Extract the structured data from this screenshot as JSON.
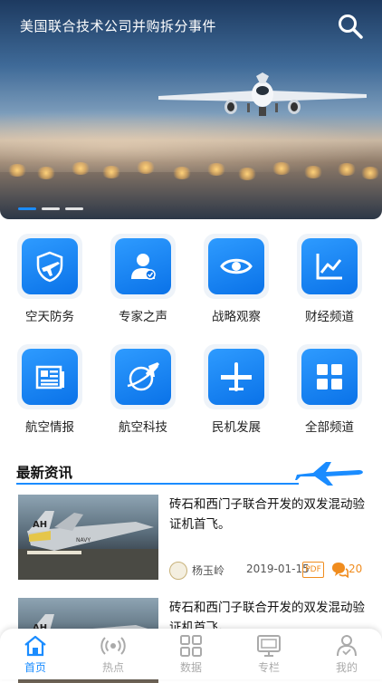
{
  "banner": {
    "title": "美国联合技术公司并购拆分事件",
    "search_icon": "search-icon",
    "slides": 3,
    "active_slide": 0
  },
  "categories": [
    {
      "label": "空天防务",
      "icon": "plane-shield-icon"
    },
    {
      "label": "专家之声",
      "icon": "expert-user-icon"
    },
    {
      "label": "战略观察",
      "icon": "eye-icon"
    },
    {
      "label": "财经频道",
      "icon": "line-chart-icon"
    },
    {
      "label": "航空情报",
      "icon": "newspaper-icon"
    },
    {
      "label": "航空科技",
      "icon": "orbit-plane-icon"
    },
    {
      "label": "民机发展",
      "icon": "airliner-icon"
    },
    {
      "label": "全部频道",
      "icon": "grid-icon"
    }
  ],
  "section": {
    "title": "最新资讯",
    "icon": "jet-plane-icon"
  },
  "news": [
    {
      "headline": "砖石和西门子联合开发的双发混动验证机首飞。",
      "author": "杨玉岭",
      "date": "2019-01-15",
      "pdf_label": "PDF",
      "comments": "20"
    },
    {
      "headline": "砖石和西门子联合开发的双发混动验证机首飞。"
    }
  ],
  "tabbar": [
    {
      "label": "首页",
      "icon": "home-icon",
      "active": true
    },
    {
      "label": "热点",
      "icon": "broadcast-icon",
      "active": false
    },
    {
      "label": "数据",
      "icon": "data-grid-icon",
      "active": false
    },
    {
      "label": "专栏",
      "icon": "monitor-icon",
      "active": false
    },
    {
      "label": "我的",
      "icon": "profile-icon",
      "active": false
    }
  ],
  "colors": {
    "accent": "#1a8cff",
    "icon_gradient_start": "#2e9bff",
    "icon_gradient_end": "#0a72e8",
    "meta_orange": "#f08c1e",
    "tab_inactive": "#aaaaaa"
  }
}
